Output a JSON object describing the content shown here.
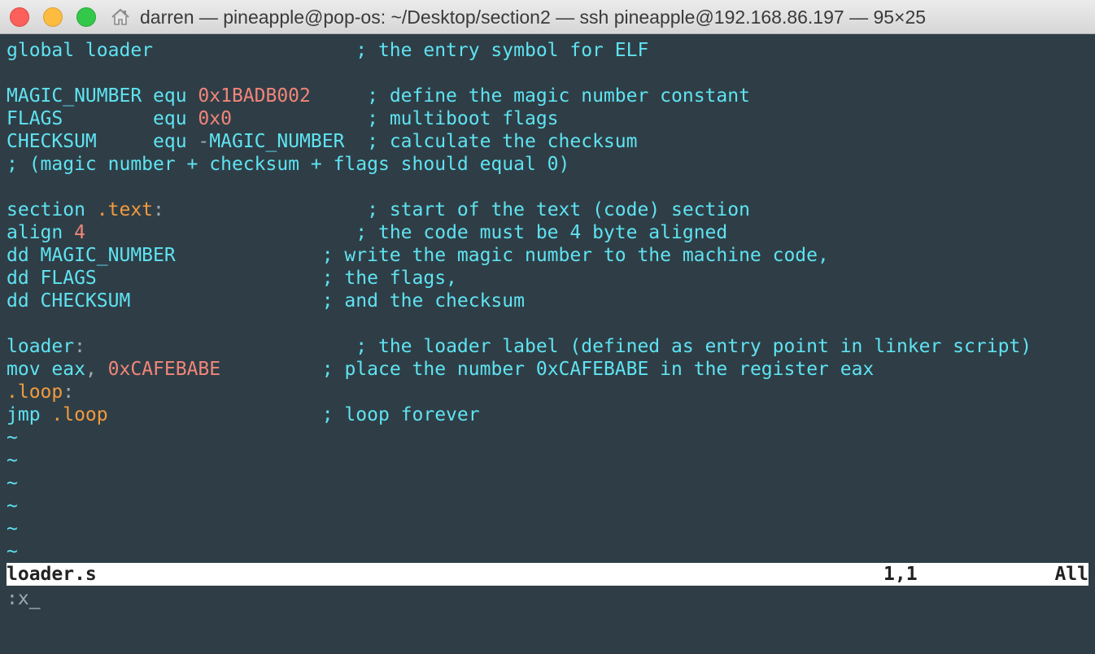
{
  "window": {
    "title": "darren — pineapple@pop-os: ~/Desktop/section2 — ssh pineapple@192.168.86.197 — 95×25"
  },
  "editor": {
    "lines": [
      {
        "a": "global loader                  ; the entry symbol for ELF"
      },
      {
        "a": ""
      },
      {
        "a": "MAGIC_NUMBER equ ",
        "b": "0x1BADB002",
        "c": "     ; define the magic number constant"
      },
      {
        "a": "FLAGS        equ ",
        "b": "0x0",
        "c": "            ; multiboot flags"
      },
      {
        "a": "CHECKSUM     equ ",
        "g": "-",
        "c": "MAGIC_NUMBER  ; calculate the checksum"
      },
      {
        "a": "; (magic number + checksum + flags should equal 0)"
      },
      {
        "a": ""
      },
      {
        "a": "section ",
        "d": ".text",
        "g": ":",
        "c": "                  ; start of the text (code) section"
      },
      {
        "a": "align ",
        "b": "4",
        "c": "                        ; the code must be 4 byte aligned"
      },
      {
        "a": "dd MAGIC_NUMBER             ; write the magic number to the machine code,"
      },
      {
        "a": "dd FLAGS                    ; the flags,"
      },
      {
        "a": "dd CHECKSUM                 ; and the checksum"
      },
      {
        "a": ""
      },
      {
        "a": "loader",
        "g": ":",
        "c": "                        ; the loader label (defined as entry point in linker script)"
      },
      {
        "a": "mov eax",
        "g": ",",
        "c": " ",
        "b": "0xCAFEBABE",
        "e": "         ; place the number 0xCAFEBABE in the register eax"
      },
      {
        "d": ".loop",
        "g": ":"
      },
      {
        "a": "jmp ",
        "d": ".loop",
        "c": "                   ; loop forever"
      }
    ],
    "tildes": [
      "~",
      "~",
      "~",
      "~",
      "~",
      "~"
    ]
  },
  "status": {
    "filename": "loader.s",
    "position": "1,1",
    "scroll": "All"
  },
  "command": {
    "text": ":x",
    "cursor": "_"
  },
  "colors": {
    "background": "#2f3e46",
    "text": "#5fe3f2",
    "number": "#f2857a",
    "directive": "#f29a3f",
    "punct": "#a0aab0"
  }
}
